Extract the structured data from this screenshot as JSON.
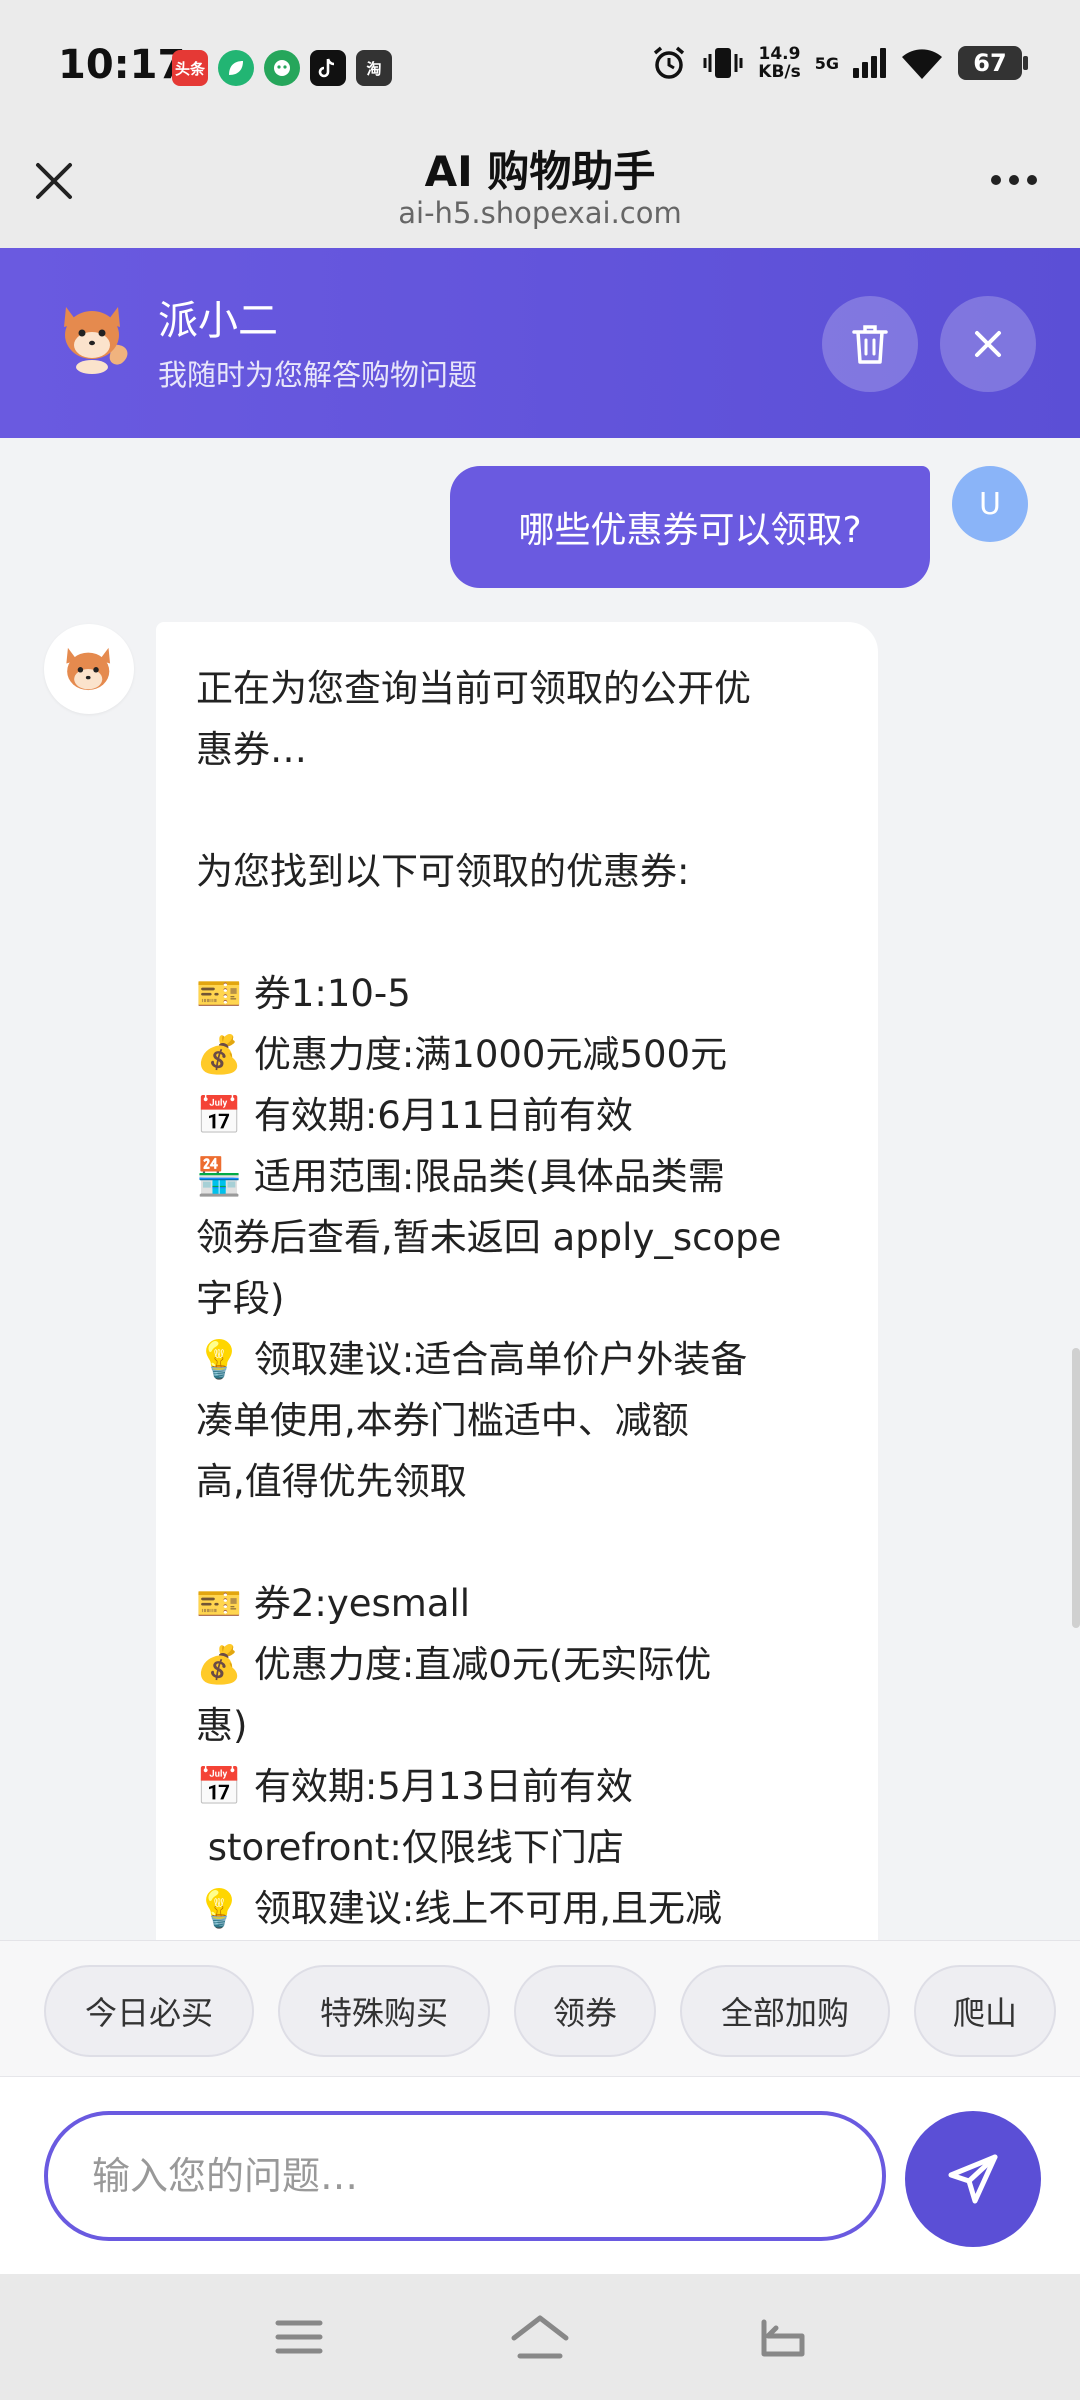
{
  "status_bar": {
    "time": "10:17",
    "notification_icons": [
      {
        "icon": "toutiao-app-icon",
        "label": "头条",
        "color": "#e53935"
      },
      {
        "icon": "green-leaf-app-icon",
        "label": "",
        "color": "#22b573"
      },
      {
        "icon": "green-face-app-icon",
        "label": "",
        "color": "#26a65b"
      },
      {
        "icon": "tiktok-app-icon",
        "label": "",
        "color": "#111111"
      },
      {
        "icon": "taobao-app-icon",
        "label": "淘",
        "color": "#333333"
      }
    ],
    "net_speed_value": "14.9",
    "net_speed_unit": "KB/s",
    "network": "5G",
    "battery": "67"
  },
  "browser": {
    "title": "AI 购物助手",
    "url": "ai-h5.shopexai.com"
  },
  "assistant": {
    "name": "派小二",
    "subtitle": "我随时为您解答购物问题"
  },
  "chat": {
    "user_message": "哪些优惠券可以领取?",
    "user_avatar_letter": "U",
    "bot_lines": [
      "正在为您查询当前可领取的公开优",
      "惠券…",
      "",
      "为您找到以下可领取的优惠券:",
      "",
      "🎫 券1:10-5",
      "💰 优惠力度:满1000元减500元",
      "📅 有效期:6月11日前有效",
      "🏪 适用范围:限品类(具体品类需",
      "领券后查看,暂未返回 apply_scope",
      "字段)",
      "💡 领取建议:适合高单价户外装备",
      "凑单使用,本券门槛适中、减额",
      "高,值得优先领取",
      "",
      "🎫 券2:yesmall",
      "💰 优惠力度:直减0元(无实际优",
      "惠)",
      "📅 有效期:5月13日前有效",
      " storefront:仅限线下门店",
      "💡 领取建议:线上不可用,且无减"
    ]
  },
  "quick_chips": [
    "今日必买",
    "特殊购买",
    "领券",
    "全部加购",
    "爬山"
  ],
  "input": {
    "placeholder": "输入您的问题…",
    "value": ""
  },
  "colors": {
    "accent": "#6a5ae0",
    "send": "#5b4fd6"
  }
}
